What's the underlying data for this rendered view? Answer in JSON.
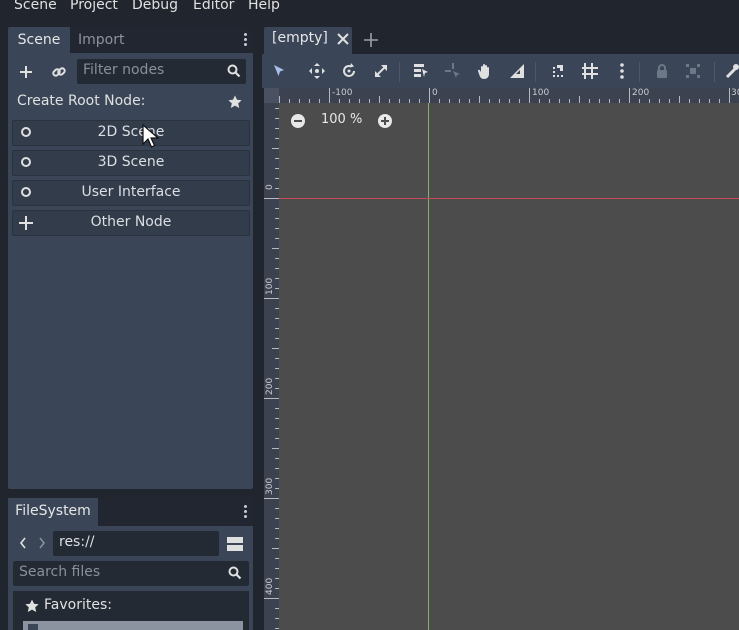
{
  "menubar": {
    "items": [
      "Scene",
      "Project",
      "Debug",
      "Editor",
      "Help"
    ]
  },
  "scene_dock": {
    "tabs": [
      "Scene",
      "Import"
    ],
    "filter_placeholder": "Filter nodes",
    "create_root_label": "Create Root Node:",
    "root_buttons": [
      {
        "label": "2D Scene",
        "icon": "node2d-icon"
      },
      {
        "label": "3D Scene",
        "icon": "spatial-icon"
      },
      {
        "label": "User Interface",
        "icon": "control-icon"
      },
      {
        "label": "Other Node",
        "icon": "add-icon"
      }
    ]
  },
  "filesystem_dock": {
    "tab": "FileSystem",
    "path": "res://",
    "search_placeholder": "Search files",
    "favorites_label": "Favorites:"
  },
  "viewport": {
    "tab_label": "[empty]",
    "zoom": "100 %",
    "ruler_top_labels": [
      "-100",
      "0",
      "100",
      "200",
      "30"
    ],
    "ruler_left_labels": [
      "0",
      "100",
      "200",
      "300",
      "400"
    ]
  },
  "colors": {
    "background": "#20252e",
    "panel": "#3a4658",
    "canvas": "#4c4c4c",
    "x_axis": "#c44a5a",
    "y_axis": "#7fb26a"
  }
}
